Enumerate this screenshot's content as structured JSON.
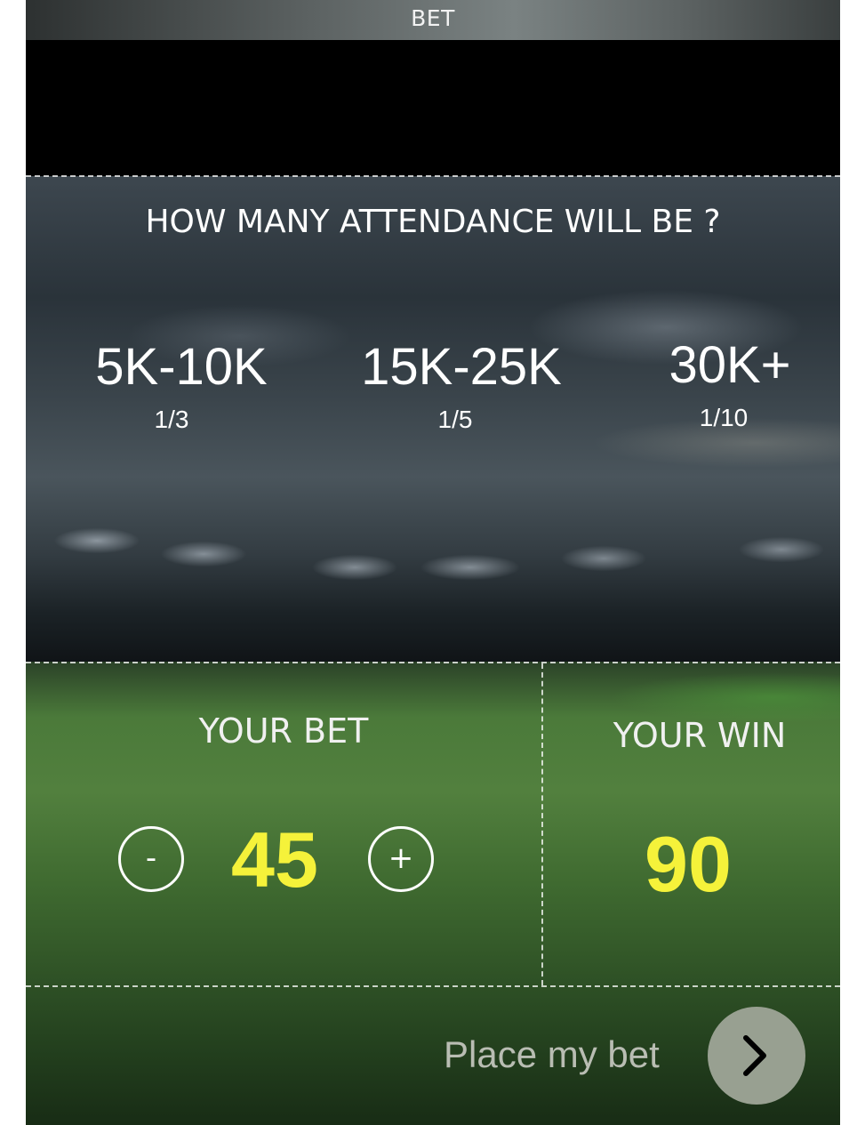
{
  "header": {
    "title": "BET"
  },
  "question": {
    "text": "HOW MANY ATTENDANCE WILL BE ?",
    "options": [
      {
        "range": "5K-10K",
        "odds": "1/3"
      },
      {
        "range": "15K-25K",
        "odds": "1/5"
      },
      {
        "range": "30K+",
        "odds": "1/10"
      }
    ]
  },
  "bet": {
    "your_bet_label": "YOUR BET",
    "minus_label": "-",
    "amount": "45",
    "plus_label": "+",
    "your_win_label": "YOUR WIN",
    "win_amount": "90"
  },
  "footer": {
    "place_bet_label": "Place my bet",
    "arrow_icon": "chevron-right-icon"
  },
  "colors": {
    "highlight": "#f5f23a",
    "action_circle": "#98a091"
  }
}
